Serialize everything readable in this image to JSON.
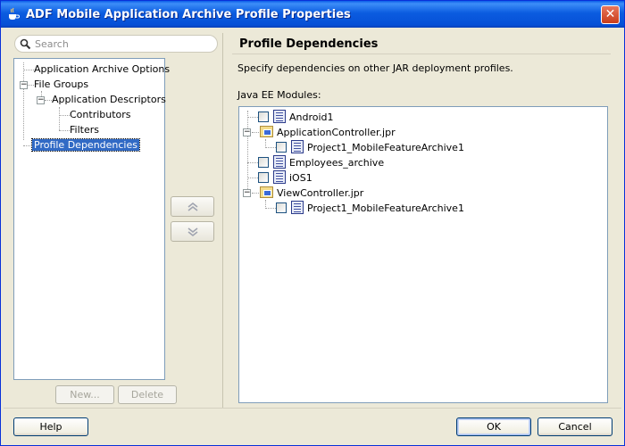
{
  "window": {
    "title": "ADF Mobile Application Archive Profile Properties",
    "close_glyph": "✕"
  },
  "search": {
    "placeholder": "Search"
  },
  "nav": {
    "items": [
      {
        "label": "Application Archive Options"
      },
      {
        "label": "File Groups"
      },
      {
        "label": "Application Descriptors"
      },
      {
        "label": "Contributors"
      },
      {
        "label": "Filters"
      },
      {
        "label": "Profile Dependencies",
        "selected": true
      }
    ],
    "new_button": "New...",
    "delete_button": "Delete"
  },
  "panel": {
    "title": "Profile Dependencies",
    "description": "Specify dependencies on other JAR deployment profiles.",
    "modules_label": "Java EE Modules:"
  },
  "modules": [
    {
      "label": "Android1",
      "type": "jar"
    },
    {
      "label": "ApplicationController.jpr",
      "type": "project"
    },
    {
      "label": "Project1_MobileFeatureArchive1",
      "type": "jar"
    },
    {
      "label": "Employees_archive",
      "type": "jar"
    },
    {
      "label": "iOS1",
      "type": "jar"
    },
    {
      "label": "ViewController.jpr",
      "type": "project"
    },
    {
      "label": "Project1_MobileFeatureArchive1",
      "type": "jar"
    }
  ],
  "footer": {
    "help": "Help",
    "ok": "OK",
    "cancel": "Cancel"
  },
  "colors": {
    "titlebar": "#0a5ee8",
    "selection": "#316ac5",
    "dialog_bg": "#ece9d8"
  }
}
